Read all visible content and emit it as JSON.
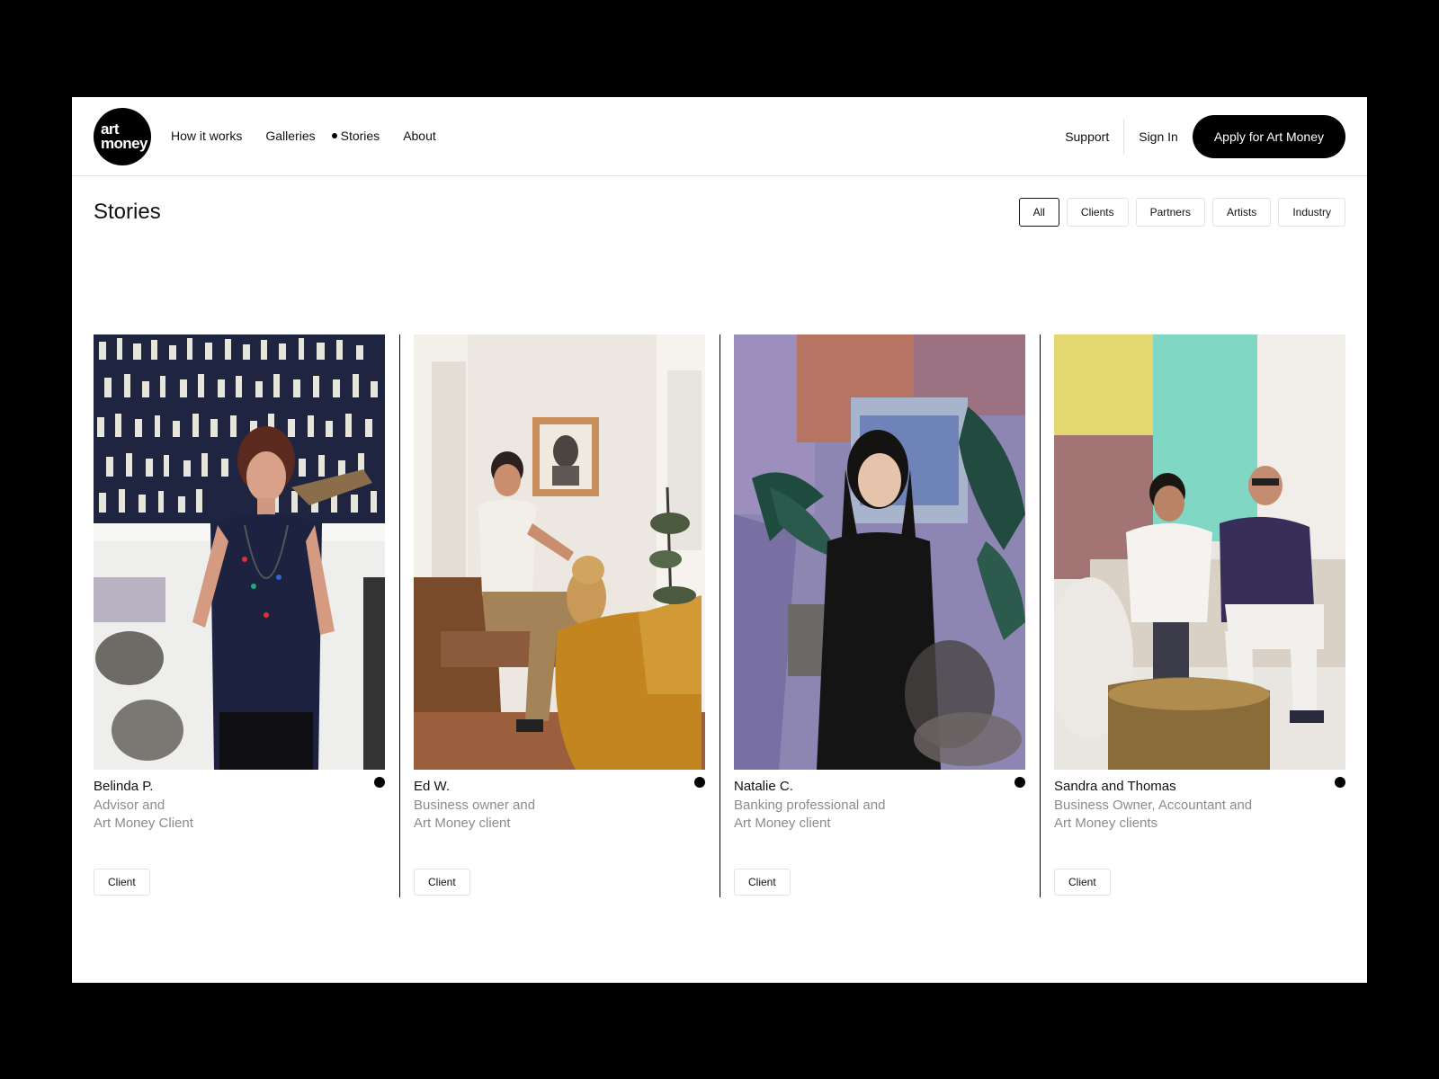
{
  "brand": {
    "logo_line1": "art",
    "logo_line2": "money"
  },
  "nav": {
    "items": [
      {
        "label": "How it works"
      },
      {
        "label": "Galleries"
      },
      {
        "label": "Stories",
        "active": true
      },
      {
        "label": "About"
      }
    ]
  },
  "header_right": {
    "support": "Support",
    "signin": "Sign In",
    "apply": "Apply for Art Money"
  },
  "page": {
    "title": "Stories"
  },
  "filters": [
    {
      "label": "All",
      "active": true
    },
    {
      "label": "Clients"
    },
    {
      "label": "Partners"
    },
    {
      "label": "Artists"
    },
    {
      "label": "Industry"
    }
  ],
  "stories": [
    {
      "name": "Belinda P.",
      "role_line1": "Advisor and",
      "role_line2": "Art Money Client",
      "tag": "Client"
    },
    {
      "name": "Ed W.",
      "role_line1": "Business owner and",
      "role_line2": "Art Money client",
      "tag": "Client"
    },
    {
      "name": "Natalie C.",
      "role_line1": "Banking professional and",
      "role_line2": "Art Money client",
      "tag": "Client"
    },
    {
      "name": "Sandra and Thomas",
      "role_line1": "Business Owner, Accountant and",
      "role_line2": "Art Money clients",
      "tag": "Client"
    }
  ],
  "colors": {
    "background": "#000000",
    "page": "#ffffff",
    "muted_text": "#8c8c8c",
    "accent": "#000000"
  }
}
